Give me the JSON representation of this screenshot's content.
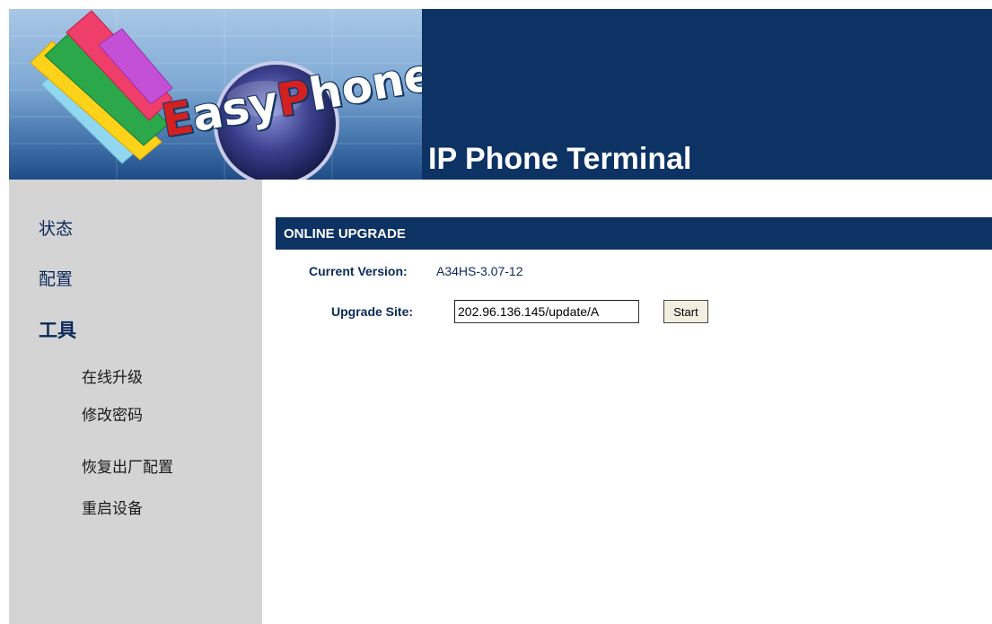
{
  "header": {
    "logo": {
      "text_cap": "E",
      "text_mid": "asy",
      "text_cap2": "P",
      "text_end": "hone"
    },
    "title": "IP Phone Terminal"
  },
  "sidebar": {
    "items": [
      {
        "label": "状态"
      },
      {
        "label": "配置"
      },
      {
        "label": "工具"
      }
    ],
    "sub_items": [
      {
        "label": "在线升级"
      },
      {
        "label": "修改密码"
      },
      {
        "label": "恢复出厂配置"
      },
      {
        "label": "重启设备"
      }
    ]
  },
  "main": {
    "section_title": "ONLINE UPGRADE",
    "current_version": {
      "label": "Current Version:",
      "value": "A34HS-3.07-12"
    },
    "upgrade_site": {
      "label": "Upgrade Site:",
      "value": "202.96.136.145/update/A"
    },
    "start_label": "Start"
  },
  "colors": {
    "header_bg": "#0d3264",
    "sidebar_bg": "#d4d4d4",
    "text_blue": "#0a2a5a"
  }
}
